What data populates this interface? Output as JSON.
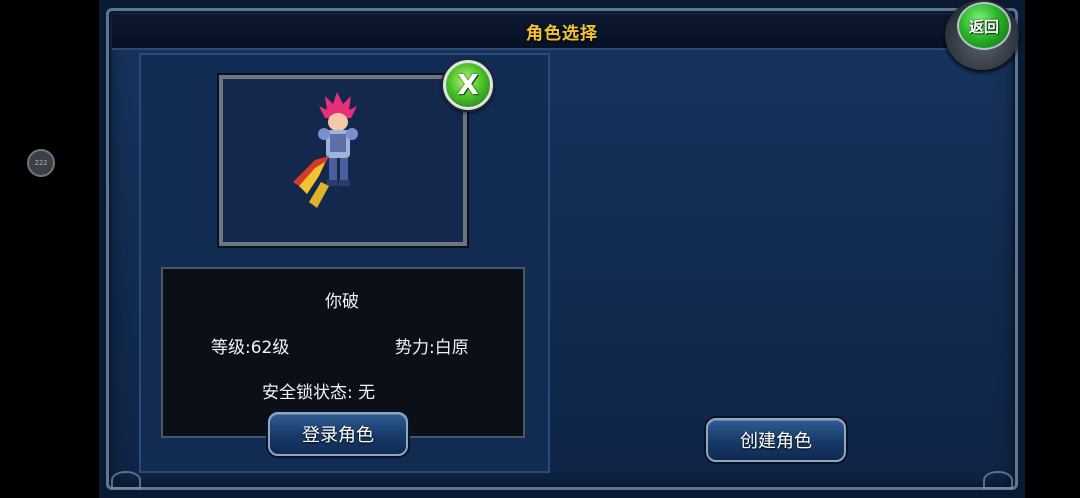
{
  "overlay": {
    "floating_assist_label": "222"
  },
  "window": {
    "title": "角色选择",
    "back_label": "返回"
  },
  "character": {
    "close_glyph": "X",
    "name": "你破",
    "level": "等级:62级",
    "faction": "势力:白原",
    "security_lock": "安全锁状态: 无",
    "login_label": "登录角色"
  },
  "create": {
    "label": "创建角色"
  },
  "colors": {
    "title_gold": "#f2c530",
    "panel_blue": "#17345e",
    "button_blue": "#2f5c93",
    "accent_green": "#2bb52a"
  }
}
